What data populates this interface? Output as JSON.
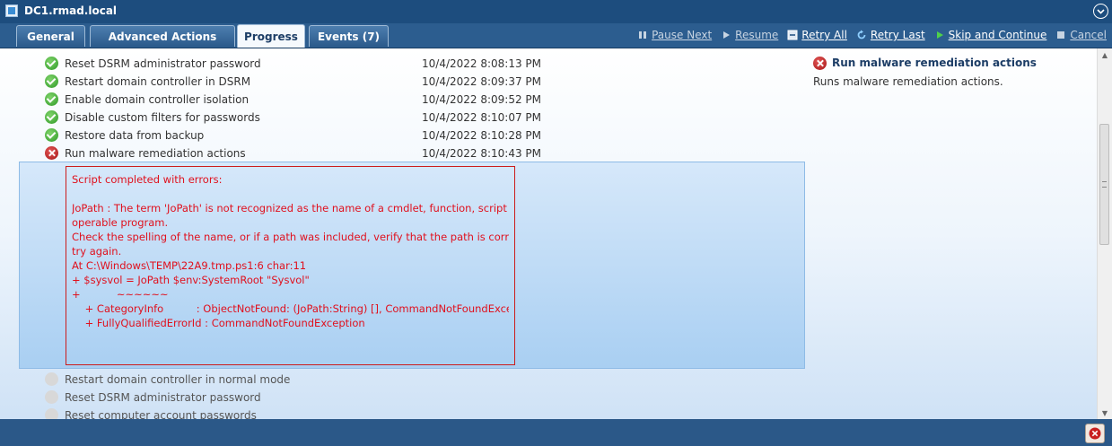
{
  "window": {
    "title": "DC1.rmad.local"
  },
  "tabs": [
    {
      "label": "General"
    },
    {
      "label": "Advanced Actions"
    },
    {
      "label": "Progress"
    },
    {
      "label": "Events (7)"
    }
  ],
  "toolbar": {
    "pause_next": "Pause Next",
    "resume": "Resume",
    "retry_all": "Retry All",
    "retry_last": "Retry Last",
    "skip_continue": "Skip and Continue",
    "cancel": "Cancel"
  },
  "steps": [
    {
      "label": "Reset DSRM administrator password",
      "time": "10/4/2022 8:08:13 PM",
      "status": "success"
    },
    {
      "label": "Restart domain controller in DSRM",
      "time": "10/4/2022 8:09:37 PM",
      "status": "success"
    },
    {
      "label": "Enable domain controller isolation",
      "time": "10/4/2022 8:09:52 PM",
      "status": "success"
    },
    {
      "label": "Disable custom filters for passwords",
      "time": "10/4/2022 8:10:07 PM",
      "status": "success"
    },
    {
      "label": "Restore data from backup",
      "time": "10/4/2022 8:10:28 PM",
      "status": "success"
    },
    {
      "label": "Run malware remediation actions",
      "time": "10/4/2022 8:10:43 PM",
      "status": "error"
    }
  ],
  "error_lines": [
    "Script completed with errors:",
    "",
    "JoPath : The term 'JoPath' is not recognized as the name of a cmdlet, function, script file, or",
    "operable program.",
    "Check the spelling of the name, or if a path was included, verify that the path is correct and",
    "try again.",
    "At C:\\Windows\\TEMP\\22A9.tmp.ps1:6 char:11",
    "+ $sysvol = JoPath $env:SystemRoot \"Sysvol\"",
    "+           ~~~~~~",
    "    + CategoryInfo          : ObjectNotFound: (JoPath:String) [], CommandNotFoundException",
    "    + FullyQualifiedErrorId : CommandNotFoundException"
  ],
  "pending_steps": [
    {
      "label": "Restart domain controller in normal mode",
      "status": "pending"
    },
    {
      "label": "Reset DSRM administrator password",
      "status": "pending"
    },
    {
      "label": "Reset computer account passwords",
      "status": "pending"
    }
  ],
  "detail": {
    "title": "Run malware remediation actions",
    "description": "Runs malware remediation actions."
  },
  "colors": {
    "error_text": "#e0101d",
    "header_bg": "#1d4d7e",
    "success": "#2f9a27",
    "error": "#a61717"
  },
  "icons": {
    "step_success": "check-circle-icon",
    "step_error": "x-circle-icon",
    "step_pending": "pending-circle-icon"
  }
}
